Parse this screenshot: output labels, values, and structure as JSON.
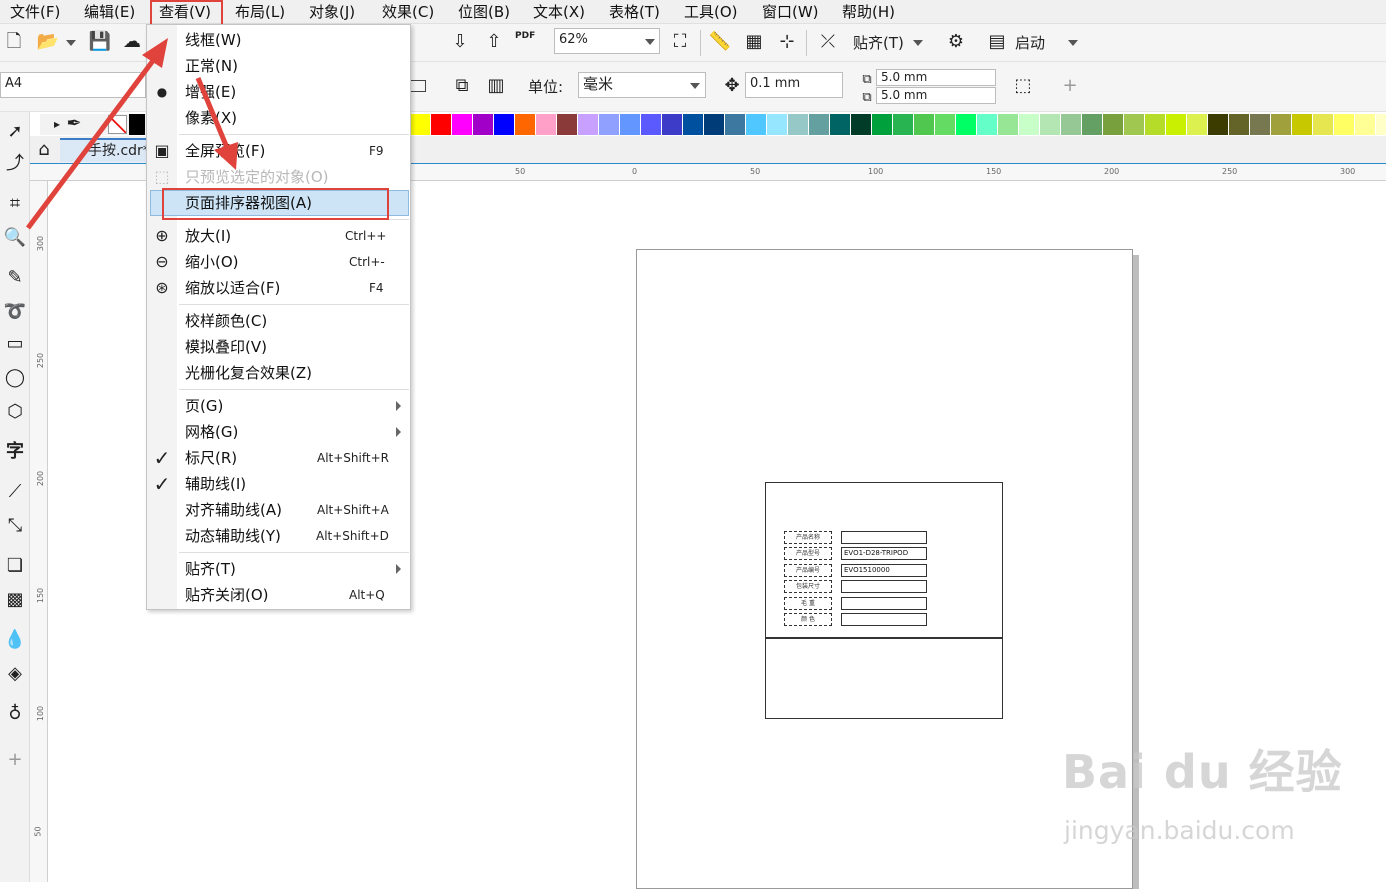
{
  "menubar": {
    "items": [
      "文件(F)",
      "编辑(E)",
      "查看(V)",
      "布局(L)",
      "对象(J)",
      "效果(C)",
      "位图(B)",
      "文本(X)",
      "表格(T)",
      "工具(O)",
      "窗口(W)",
      "帮助(H)"
    ]
  },
  "toolbar": {
    "zoom_value": "62%",
    "snap_label": "贴齐(T)",
    "launch_label": "启动",
    "pdf_label": "PDF"
  },
  "propbar": {
    "page_size": "A4",
    "unit_label": "单位:",
    "unit_value": "毫米",
    "nudge_value": "0.1 mm",
    "dup_x": "5.0 mm",
    "dup_y": "5.0 mm"
  },
  "palette_colors": [
    "#ffff00",
    "#ff0000",
    "#ff00ff",
    "#a000c8",
    "#0000ff",
    "#ff6600",
    "#ffa0c8",
    "#8b3a3a",
    "#c8a0ff",
    "#8fa0ff",
    "#6496ff",
    "#5a5aff",
    "#3c3cc8",
    "#0050a0",
    "#003c78",
    "#3c78a0",
    "#50c8ff",
    "#96e6ff",
    "#96c8c8",
    "#64a0a0",
    "#006464",
    "#003c28",
    "#00a03c",
    "#28b450",
    "#50c850",
    "#64dc64",
    "#00ff64",
    "#64ffc8",
    "#96e696",
    "#c8ffc8",
    "#b4e6b4",
    "#96c896",
    "#64a064",
    "#78a03c",
    "#a0c850",
    "#b4dc28",
    "#c8f000",
    "#dcf050",
    "#3c3c00",
    "#646428",
    "#787850",
    "#a0a03c",
    "#c8c800",
    "#e6e650",
    "#ffff64",
    "#ffff96",
    "#ffffc8",
    "#a0643c"
  ],
  "document": {
    "tab_name": "手按.cdr*"
  },
  "ruler": {
    "h_ticks": [
      "50",
      "0",
      "50",
      "100",
      "150",
      "200",
      "250",
      "300"
    ],
    "v_ticks": [
      "300",
      "250",
      "200",
      "150",
      "100",
      "50"
    ]
  },
  "view_menu": {
    "items": [
      {
        "label": "线框(W)",
        "shortcut": ""
      },
      {
        "label": "正常(N)",
        "shortcut": ""
      },
      {
        "label": "增强(E)",
        "shortcut": ""
      },
      {
        "label": "像素(X)",
        "shortcut": ""
      },
      {
        "label": "全屏预览(F)",
        "shortcut": "F9"
      },
      {
        "label": "只预览选定的对象(O)",
        "shortcut": ""
      },
      {
        "label": "页面排序器视图(A)",
        "shortcut": ""
      },
      {
        "label": "放大(I)",
        "shortcut": "Ctrl++"
      },
      {
        "label": "缩小(O)",
        "shortcut": "Ctrl+-"
      },
      {
        "label": "缩放以适合(F)",
        "shortcut": "F4"
      },
      {
        "label": "校样颜色(C)",
        "shortcut": ""
      },
      {
        "label": "模拟叠印(V)",
        "shortcut": ""
      },
      {
        "label": "光栅化复合效果(Z)",
        "shortcut": ""
      },
      {
        "label": "页(G)",
        "shortcut": ""
      },
      {
        "label": "网格(G)",
        "shortcut": ""
      },
      {
        "label": "标尺(R)",
        "shortcut": "Alt+Shift+R"
      },
      {
        "label": "辅助线(I)",
        "shortcut": ""
      },
      {
        "label": "对齐辅助线(A)",
        "shortcut": "Alt+Shift+A"
      },
      {
        "label": "动态辅助线(Y)",
        "shortcut": "Alt+Shift+D"
      },
      {
        "label": "贴齐(T)",
        "shortcut": ""
      },
      {
        "label": "贴齐关闭(O)",
        "shortcut": "Alt+Q"
      }
    ]
  },
  "label_card": {
    "rows": [
      {
        "key": "产品名称",
        "value": ""
      },
      {
        "key": "产品型号",
        "value": "EVO1-D28-TRIPOD"
      },
      {
        "key": "产品编号",
        "value": "EVO1510000"
      },
      {
        "key": "包装尺寸",
        "value": ""
      },
      {
        "key": "毛 重",
        "value": ""
      },
      {
        "key": "颜 色",
        "value": ""
      }
    ]
  },
  "watermark": {
    "brand": "Bai du 经验",
    "url": "jingyan.baidu.com"
  },
  "colors": {
    "highlight_red": "#e0433c",
    "active_item_bg": "#cde4f7",
    "tab_accent": "#3a7cc6"
  }
}
